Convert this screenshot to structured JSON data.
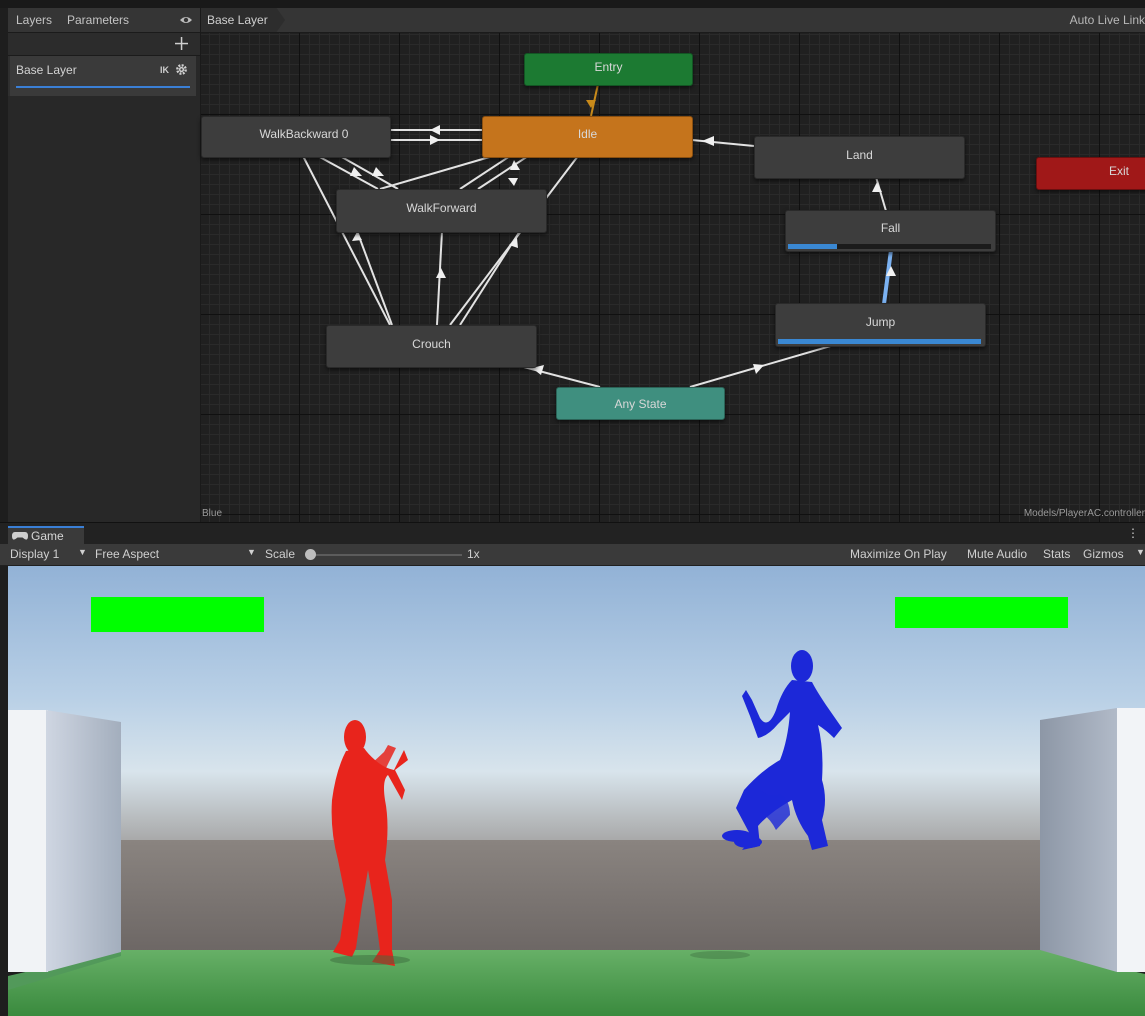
{
  "layers_panel": {
    "tabs": [
      "Layers",
      "Parameters"
    ],
    "add_icon": "plus-icon",
    "visibility_icon": "eye-icon",
    "layer": {
      "name": "Base Layer",
      "ik_label": "IK",
      "settings_icon": "gear-icon"
    }
  },
  "graph": {
    "breadcrumb": "Base Layer",
    "auto_live_link": "Auto Live Link",
    "footer_left": "Blue",
    "footer_right": "Models/PlayerAC.controller",
    "states": {
      "entry": "Entry",
      "idle": "Idle",
      "walk_backward": "WalkBackward 0",
      "walk_forward": "WalkForward",
      "land": "Land",
      "exit": "Exit",
      "fall": "Fall",
      "jump": "Jump",
      "crouch": "Crouch",
      "any_state": "Any State"
    },
    "progress": {
      "fall": 0.24,
      "jump": 1.0
    },
    "colors": {
      "entry": "#1c7a32",
      "idle": "#c5741c",
      "exit": "#a01818",
      "any_state": "#3f8f7f",
      "state": "#3d3d3d",
      "transition": "#e2e2e2",
      "active_transition": "#7bb2f2",
      "entry_transition": "#c88a1a",
      "progress": "#3a88d3"
    }
  },
  "game": {
    "tab_label": "Game",
    "tab_icon": "gamepad-icon",
    "display": "Display 1",
    "aspect": "Free Aspect",
    "scale_label": "Scale",
    "scale_value": "1x",
    "toolbar_buttons": [
      "Maximize On Play",
      "Mute Audio",
      "Stats",
      "Gizmos"
    ],
    "menu_icon": "kebab-menu-icon",
    "scene": {
      "health_bar_color": "#00ff00",
      "player_red_color": "#e8241c",
      "player_blue_color": "#1c28d8",
      "ground_color": "#5aa85a"
    }
  }
}
